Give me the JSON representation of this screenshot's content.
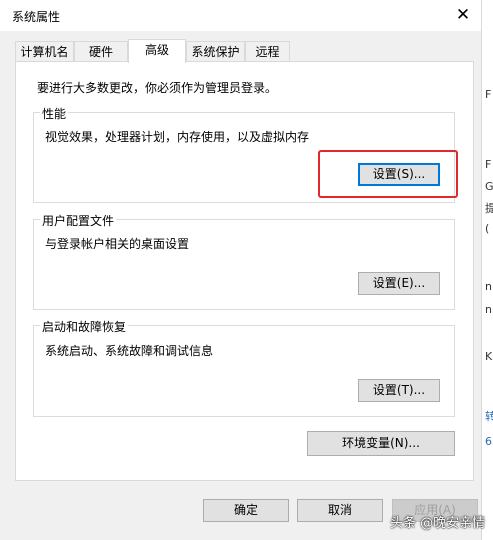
{
  "window": {
    "title": "系统属性",
    "close_glyph": "✕"
  },
  "tabs": [
    {
      "label": "计算机名",
      "active": false
    },
    {
      "label": "硬件",
      "active": false
    },
    {
      "label": "高级",
      "active": true
    },
    {
      "label": "系统保护",
      "active": false
    },
    {
      "label": "远程",
      "active": false
    }
  ],
  "admin_notice": "要进行大多数更改，你必须作为管理员登录。",
  "performance": {
    "label": "性能",
    "description": "视觉效果，处理器计划，内存使用，以及虚拟内存",
    "settings_button": "设置(S)..."
  },
  "user_profiles": {
    "label": "用户配置文件",
    "description": "与登录帐户相关的桌面设置",
    "settings_button": "设置(E)..."
  },
  "startup_recovery": {
    "label": "启动和故障恢复",
    "description": "系统启动、系统故障和调试信息",
    "settings_button": "设置(T)..."
  },
  "env_vars_button": "环境变量(N)...",
  "footer": {
    "ok": "确定",
    "cancel": "取消",
    "apply": "应用(A)"
  },
  "background_fragments": [
    "F",
    "G",
    "提",
    "(",
    "n",
    "n",
    "K",
    "转",
    "6"
  ],
  "watermark": "头条 @晚安亲情",
  "colors": {
    "highlight": "#e0282e",
    "focus": "#0078d7"
  }
}
